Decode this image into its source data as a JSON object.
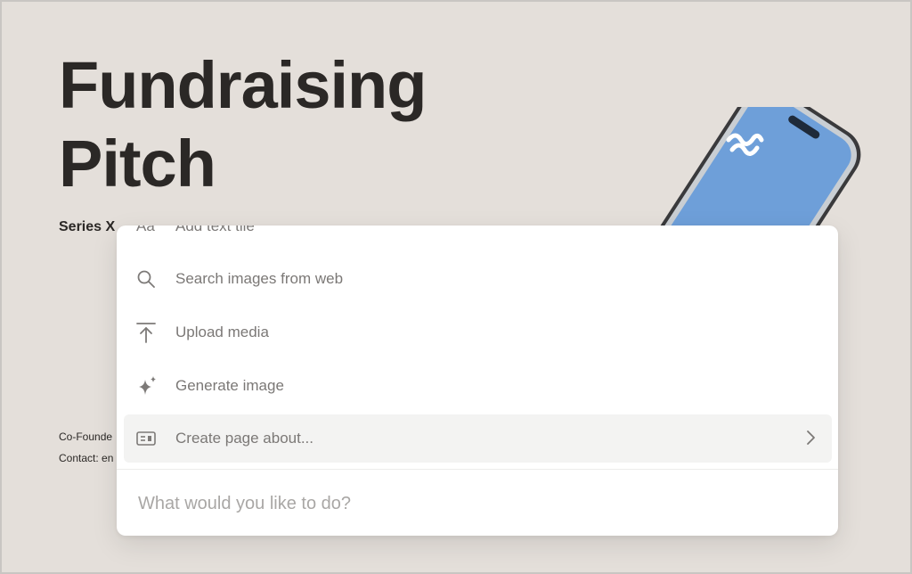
{
  "page": {
    "title_line1": "Fundraising",
    "title_line2": "Pitch",
    "subtitle": "Series X",
    "cofounder_label": "Co-Founde",
    "contact_label": "Contact: en"
  },
  "palette": {
    "items": [
      {
        "label": "Add text tile",
        "icon": "text-tile-icon"
      },
      {
        "label": "Search images from web",
        "icon": "search-icon"
      },
      {
        "label": "Upload media",
        "icon": "upload-icon"
      },
      {
        "label": "Generate image",
        "icon": "sparkle-icon"
      },
      {
        "label": "Create page about...",
        "icon": "card-icon",
        "active": true
      }
    ],
    "text_tile_glyph": "Aa",
    "prompt_placeholder": "What would you like to do?"
  },
  "colors": {
    "background": "#e4dfda",
    "phone_screen": "#6e9fd9",
    "text_dark": "#2b2826",
    "menu_text": "#7b7876"
  }
}
